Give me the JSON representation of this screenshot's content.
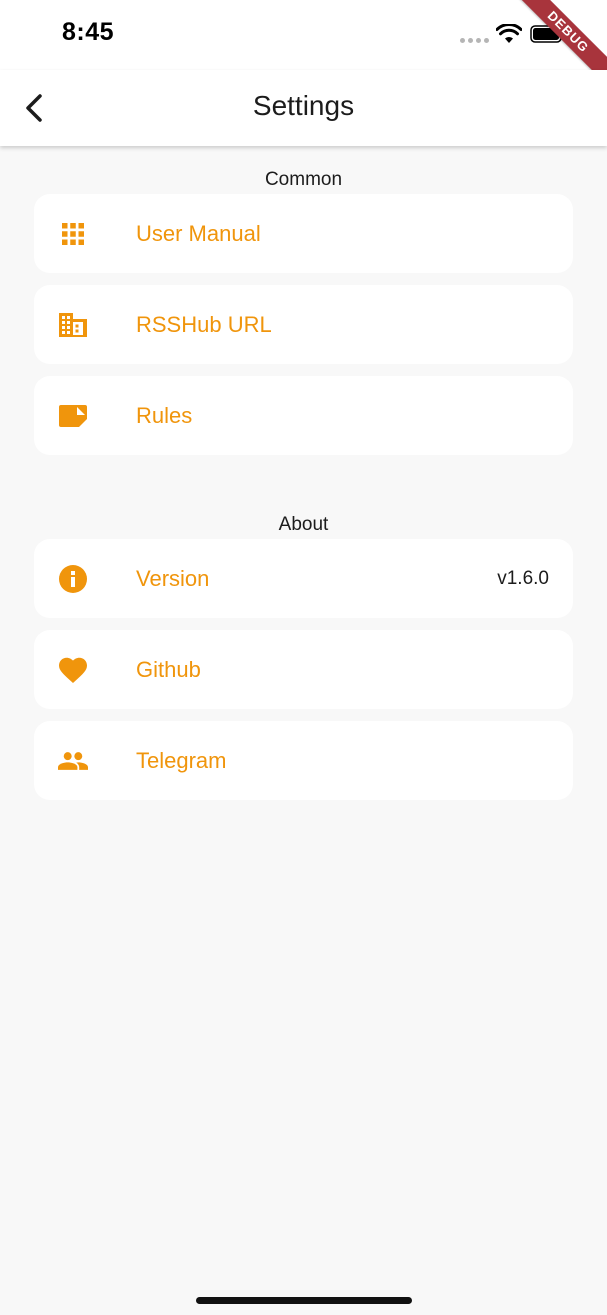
{
  "status_bar": {
    "time": "8:45"
  },
  "debug_ribbon": "DEBUG",
  "app_bar": {
    "title": "Settings"
  },
  "accent_color": "#f0950c",
  "sections": [
    {
      "title": "Common",
      "items": [
        {
          "label": "User Manual",
          "icon": "apps-grid-icon"
        },
        {
          "label": "RSSHub URL",
          "icon": "building-icon"
        },
        {
          "label": "Rules",
          "icon": "note-icon"
        }
      ]
    },
    {
      "title": "About",
      "items": [
        {
          "label": "Version",
          "icon": "info-icon",
          "value": "v1.6.0"
        },
        {
          "label": "Github",
          "icon": "heart-icon"
        },
        {
          "label": "Telegram",
          "icon": "people-icon"
        }
      ]
    }
  ]
}
